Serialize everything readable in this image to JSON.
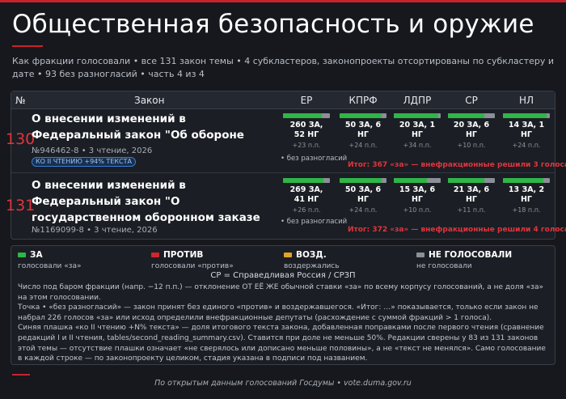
{
  "header": {
    "title": "Общественная безопасность и оружие",
    "subtitle": "Как фракции голосовали • все 131 закон темы • 4 субкластеров, законопроекты отсортированы по субкластеру и дате • 93 без разногласий • часть 4 из 4"
  },
  "table": {
    "col_num": "№",
    "col_law": "Закон",
    "factions": [
      "ЕР",
      "КПРФ",
      "ЛДПР",
      "СР",
      "НЛ"
    ],
    "rows": [
      {
        "num": "130",
        "title": "О внесении изменений в Федеральный закон \"Об обороне",
        "meta": "№946462-8 • 3 чтение, 2026",
        "badge": "КО II ЧТЕНИЮ +94% ТЕКСТА",
        "consensus": "• без разногласий",
        "itog": "Итог: 367 «за» — внефракционные решили 3 голоса",
        "votes": [
          {
            "label": "260 ЗА, 52 НГ",
            "line1": "260 ЗА,",
            "line2": "52 НГ",
            "dev": "+23 п.п.",
            "za_share": 0.83
          },
          {
            "label": "50 ЗА, 6 НГ",
            "line1": "50 ЗА, 6 НГ",
            "line2": "",
            "dev": "+24 п.п.",
            "za_share": 0.89
          },
          {
            "label": "20 ЗА, 1 НГ",
            "line1": "20 ЗА, 1 НГ",
            "line2": "",
            "dev": "+34 п.п.",
            "za_share": 0.95
          },
          {
            "label": "20 ЗА, 6 НГ",
            "line1": "20 ЗА, 6 НГ",
            "line2": "",
            "dev": "+10 п.п.",
            "za_share": 0.77
          },
          {
            "label": "14 ЗА, 1 НГ",
            "line1": "14 ЗА, 1 НГ",
            "line2": "",
            "dev": "+24 п.п.",
            "za_share": 0.93
          }
        ]
      },
      {
        "num": "131",
        "title": "О внесении изменений в Федеральный закон \"О государственном оборонном заказе",
        "meta": "№1169099-8 • 3 чтение, 2026",
        "badge": "",
        "consensus": "• без разногласий",
        "itog": "Итог: 372 «за» — внефракционные решили 4 голоса",
        "votes": [
          {
            "label": "269 ЗА, 41 НГ",
            "line1": "269 ЗА,",
            "line2": "41 НГ",
            "dev": "+26 п.п.",
            "za_share": 0.87
          },
          {
            "label": "50 ЗА, 6 НГ",
            "line1": "50 ЗА, 6 НГ",
            "line2": "",
            "dev": "+24 п.п.",
            "za_share": 0.89
          },
          {
            "label": "15 ЗА, 6 НГ",
            "line1": "15 ЗА, 6 НГ",
            "line2": "",
            "dev": "+10 п.п.",
            "za_share": 0.71
          },
          {
            "label": "21 ЗА, 6 НГ",
            "line1": "21 ЗА, 6 НГ",
            "line2": "",
            "dev": "+11 п.п.",
            "za_share": 0.78
          },
          {
            "label": "13 ЗА, 2 НГ",
            "line1": "13 ЗА, 2 НГ",
            "line2": "",
            "dev": "+18 п.п.",
            "za_share": 0.87
          }
        ]
      }
    ]
  },
  "legend": {
    "items": [
      {
        "key": "ЗА",
        "desc": "голосовали «за»",
        "color": "#2fb548"
      },
      {
        "key": "ПРОТИВ",
        "desc": "голосовали «против»",
        "color": "#d0262f"
      },
      {
        "key": "ВОЗД.",
        "desc": "воздержались",
        "color": "#e0a32a"
      },
      {
        "key": "НЕ ГОЛОСОВАЛИ",
        "desc": "не голосовали",
        "color": "#8b8f97"
      }
    ],
    "sr_note": "СР = Справедливая Россия / СРЗП",
    "notes": [
      "Число под баром фракции (напр. −12 п.п.) — отклонение ОТ ЕЁ ЖЕ обычной ставки «за» по всему корпусу голосований, а не доля «за» на этом голосовании.",
      "Точка • «без разногласий» — закон принят без единого «против» и воздержавшегося. «Итог: …» показывается, только если закон не набрал 226 голосов «за» или исход определили внефракционные депутаты (расхождение с суммой фракций > 1 голоса).",
      "Синяя плашка «ко II чтению +N% текста» — доля итогового текста закона, добавленная поправками после первого чтения (сравнение редакций I и II чтения, tables/second_reading_summary.csv). Ставится при доле не меньше 50%. Редакции сверены у 83 из 131 законов этой темы — отсутствие плашки означает «не сверялось или дописано меньше половины», а не «текст не менялся». Само голосование в каждой строке — по законопроекту целиком, стадия указана в подписи под названием."
    ]
  },
  "footer": {
    "source": "По открытым данным голосований Госдумы • vote.duma.gov.ru"
  },
  "colors": {
    "accent": "#c8232c",
    "za": "#2fb548",
    "ng": "#8b8f97",
    "itog": "#e0353d"
  }
}
